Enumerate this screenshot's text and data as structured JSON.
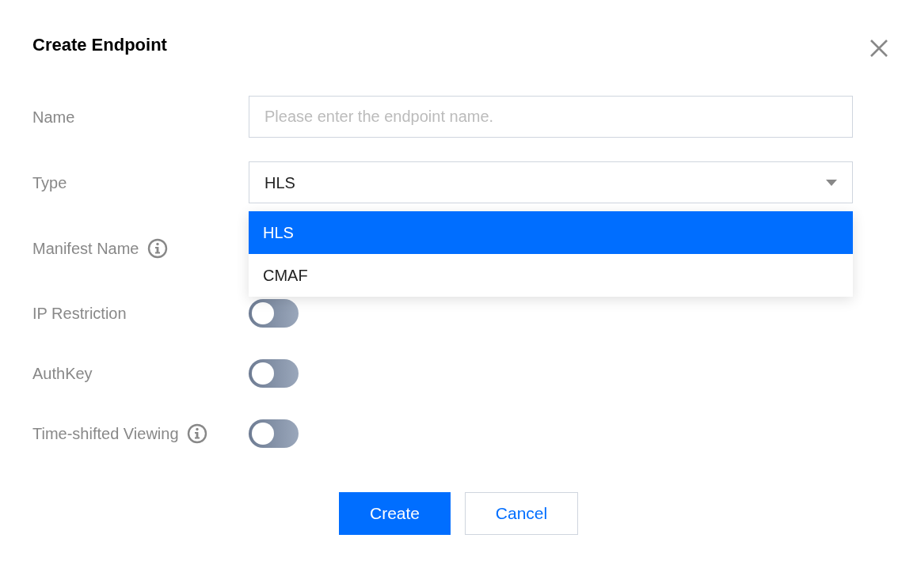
{
  "dialog": {
    "title": "Create Endpoint"
  },
  "fields": [
    {
      "kind": "text",
      "label": "Name",
      "placeholder": "Please enter the endpoint name."
    },
    {
      "kind": "select",
      "label": "Type",
      "value": "HLS",
      "expanded": true,
      "options": [
        {
          "label": "HLS",
          "selected": true
        },
        {
          "label": "CMAF",
          "selected": false
        }
      ]
    },
    {
      "kind": "covered",
      "label": "Manifest Name",
      "info": true
    },
    {
      "kind": "switch",
      "label": "IP Restriction",
      "on": false
    },
    {
      "kind": "switch",
      "label": "AuthKey",
      "on": false
    },
    {
      "kind": "switch",
      "label": "Time-shifted Viewing",
      "info": true,
      "on": false
    }
  ],
  "buttons": [
    {
      "label": "Create",
      "kind": "primary"
    },
    {
      "label": "Cancel",
      "kind": "secondary"
    }
  ]
}
